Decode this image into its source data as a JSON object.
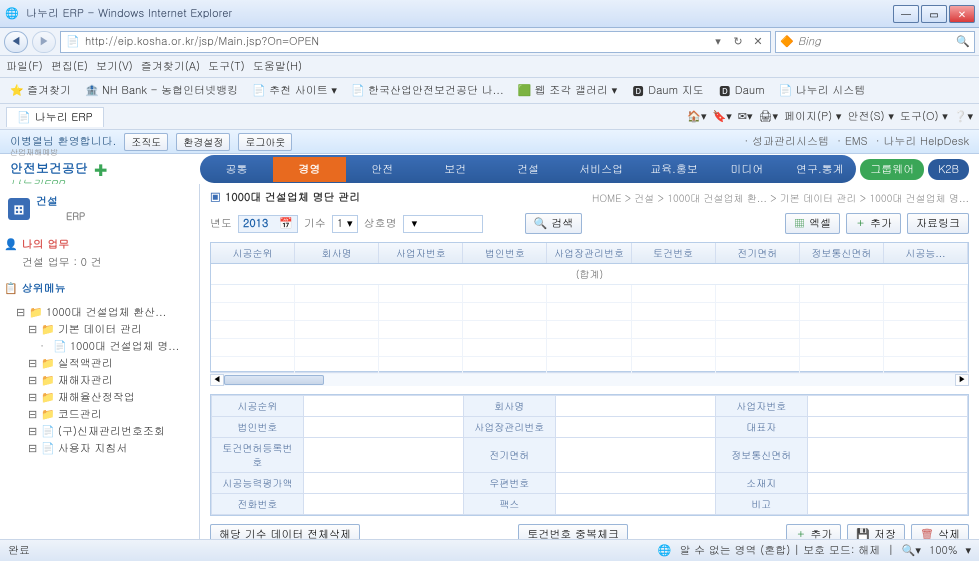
{
  "window": {
    "title": "나누리 ERP - Windows Internet Explorer",
    "url": "http://eip.kosha.or.kr/jsp/Main.jsp?On=OPEN",
    "search_engine": "Bing"
  },
  "ie_menu": [
    "파일(F)",
    "편집(E)",
    "보기(V)",
    "즐겨찾기(A)",
    "도구(T)",
    "도움말(H)"
  ],
  "favbar": {
    "favorites": "즐겨찾기",
    "items": [
      "NH Bank - 농협인터넷뱅킹",
      "추천 사이트 ▾",
      "한국산업안전보건공단 나...",
      "웹 조각 갤러리 ▾",
      "Daum 지도",
      "Daum",
      "나누리 시스템"
    ]
  },
  "tab": "나누리 ERP",
  "rt_tools": [
    "페이지(P) ▾",
    "안전(S) ▾",
    "도구(O) ▾"
  ],
  "welcome": {
    "greeting": "이병열님 환영합니다.",
    "btns": [
      "조직도",
      "환경설정",
      "로그아웃"
    ],
    "links": [
      "· 성과관리시스템",
      "· EMS",
      "· 나누리 HelpDesk"
    ]
  },
  "logo": {
    "line1": "산업재해예방",
    "line2": "안전보건공단",
    "line3": "나누리ERP"
  },
  "tabs": [
    "공통",
    "경영",
    "안전",
    "보건",
    "건설",
    "서비스업",
    "교육.홍보",
    "미디어",
    "연구.통계"
  ],
  "active_tab_index": 1,
  "pills": {
    "groupware": "그룹웨어",
    "k2b": "K2B"
  },
  "sidebar": {
    "module": "건설",
    "module_sub": "ERP",
    "my_tasks": "나의 업무",
    "my_tasks_count": "건설 업무 : 0 건",
    "upper_menu": "상위메뉴",
    "tree": [
      {
        "lvl": 1,
        "ico": "folder",
        "txt": "1000대 건설업체 환산..."
      },
      {
        "lvl": 2,
        "ico": "folder",
        "txt": "기본 데이터 관리"
      },
      {
        "lvl": 3,
        "ico": "doc",
        "txt": "1000대 건설업체 명..."
      },
      {
        "lvl": 2,
        "ico": "folder",
        "txt": "실적액관리"
      },
      {
        "lvl": 2,
        "ico": "folder",
        "txt": "재해자관리"
      },
      {
        "lvl": 2,
        "ico": "folder",
        "txt": "재해율산정작업"
      },
      {
        "lvl": 2,
        "ico": "folder",
        "txt": "코드관리"
      },
      {
        "lvl": 2,
        "ico": "doc",
        "txt": "(구)신재관리번호조회"
      },
      {
        "lvl": 2,
        "ico": "doc",
        "txt": "사용자 지침서"
      }
    ]
  },
  "page": {
    "title": "1000대 건설업체 명단 관리",
    "breadcrumb": "HOME > 건설 > 1000대 건설업체 환... > 기본 데이터 관리 > 1000대 건설업체 명..."
  },
  "filter": {
    "year_label": "년도",
    "year_value": "2013",
    "gisu_label": "기수",
    "gisu_value": "1",
    "sangho_label": "상호명",
    "search_btn": "검색",
    "excel_btn": "엑셀",
    "add_btn": "추가",
    "datalink_btn": "자료링크"
  },
  "grid": {
    "columns": [
      "시공순위",
      "회사명",
      "사업자번호",
      "법인번호",
      "사업장관리번호",
      "토건번호",
      "전기면허",
      "정보통신면허",
      "시공능..."
    ],
    "summary": "(합계)"
  },
  "form": {
    "rows": [
      [
        "시공순위",
        "",
        "회사명",
        "",
        "사업자번호",
        ""
      ],
      [
        "법인번호",
        "",
        "사업장관리번호",
        "",
        "대표자",
        ""
      ],
      [
        "토건면허등록번호",
        "",
        "전기면허",
        "",
        "정보통신면허",
        ""
      ],
      [
        "시공능력평가액",
        "",
        "우편번호",
        "",
        "소재지",
        ""
      ],
      [
        "전화번호",
        "",
        "팩스",
        "",
        "비고",
        ""
      ]
    ]
  },
  "actions": {
    "delete_all": "해당 기수 데이터 전체삭제",
    "dup_check": "토건번호 중복체크",
    "add": "추가",
    "save": "저장",
    "delete": "삭제"
  },
  "status": {
    "done": "완료",
    "zone": "알 수 없는 영역 (혼합) | 보호 모드: 해제",
    "zoom": "100%"
  }
}
